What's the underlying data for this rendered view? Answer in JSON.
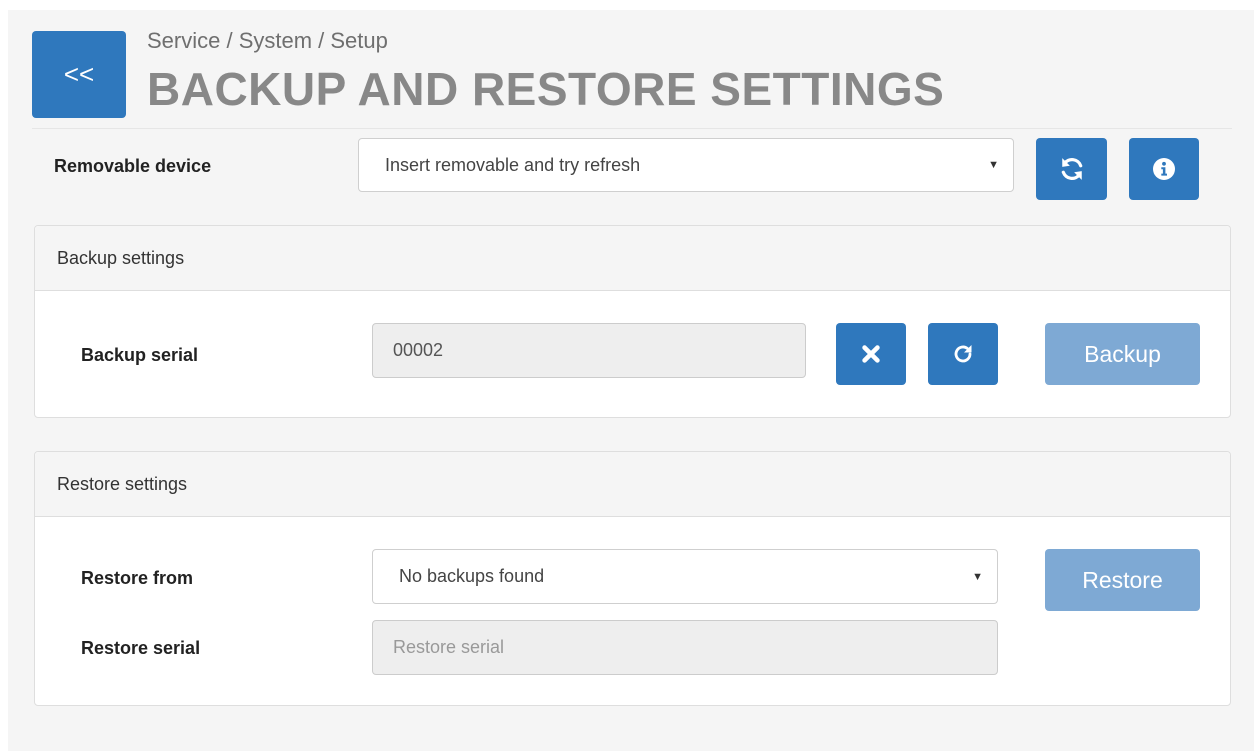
{
  "header": {
    "back_label": "<<",
    "breadcrumb": "Service / System / Setup",
    "title": "BACKUP AND RESTORE SETTINGS"
  },
  "device": {
    "label": "Removable device",
    "select_value": "Insert removable and try refresh",
    "refresh_icon": "sync-icon",
    "info_icon": "info-icon"
  },
  "backup_panel": {
    "heading": "Backup settings",
    "serial_label": "Backup serial",
    "serial_value": "00002",
    "clear_icon": "times-icon",
    "reset_icon": "rotate-icon",
    "button_label": "Backup"
  },
  "restore_panel": {
    "heading": "Restore settings",
    "from_label": "Restore from",
    "from_value": "No backups found",
    "serial_label": "Restore serial",
    "serial_placeholder": "Restore serial",
    "button_label": "Restore"
  },
  "colors": {
    "primary": "#2f78bd",
    "primary_disabled": "#7ea9d4",
    "title_gray": "#888888"
  }
}
